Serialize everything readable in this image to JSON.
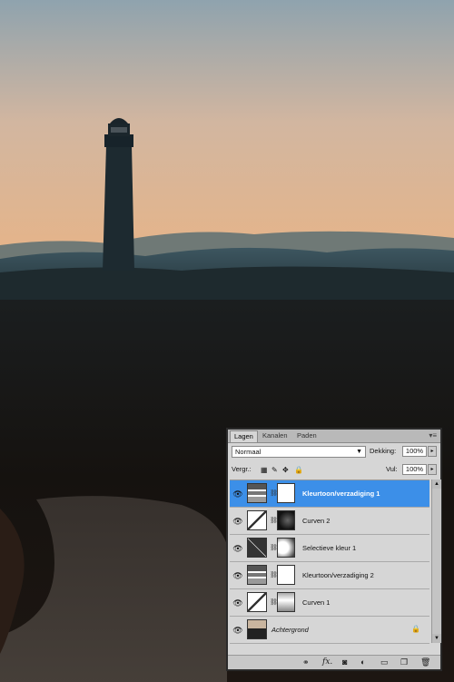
{
  "panel": {
    "tabs": [
      "Lagen",
      "Kanalen",
      "Paden"
    ],
    "blend_mode": "Normaal",
    "opacity_label": "Dekking:",
    "opacity_value": "100%",
    "lock_label": "Vergr.:",
    "fill_label": "Vul:",
    "fill_value": "100%",
    "layers": [
      {
        "name": "Kleurtoon/verzadiging 1",
        "type": "hue-saturation-icon",
        "selected": true
      },
      {
        "name": "Curven 2",
        "type": "curves-icon"
      },
      {
        "name": "Selectieve kleur 1",
        "type": "selective-color-icon"
      },
      {
        "name": "Kleurtoon/verzadiging 2",
        "type": "hue-saturation-icon"
      },
      {
        "name": "Curven 1",
        "type": "curves-icon"
      },
      {
        "name": "Achtergrond",
        "type": "photo-thumbnail",
        "locked": true
      }
    ],
    "footer_icons": [
      "link-layers-icon",
      "fx-icon",
      "add-mask-icon",
      "adjustment-layer-icon",
      "new-group-icon",
      "new-layer-icon",
      "trash-icon"
    ]
  }
}
